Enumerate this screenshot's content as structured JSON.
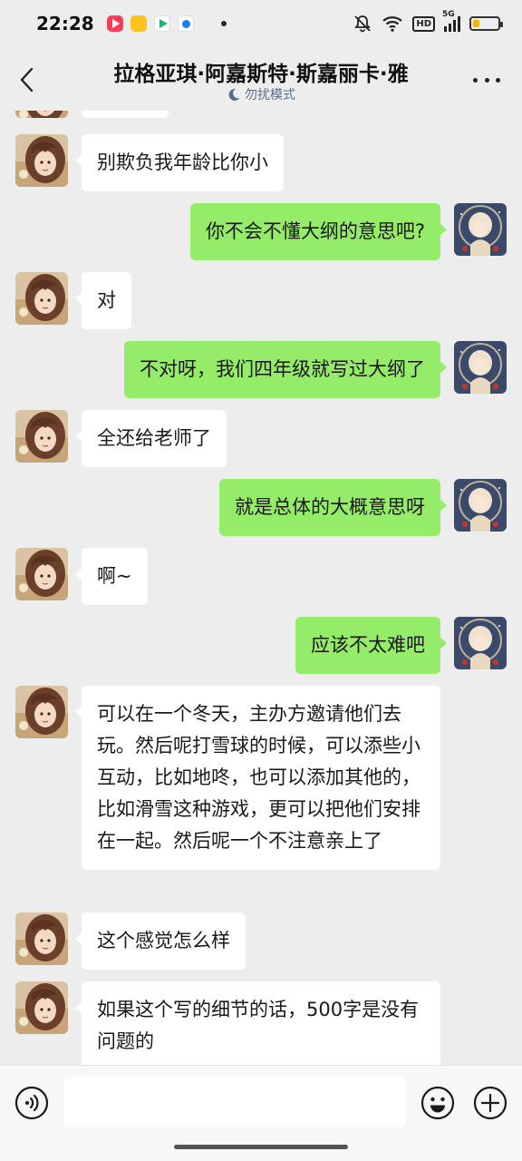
{
  "status_bar": {
    "time": "22:28",
    "network": "5G",
    "hd_label": "HD",
    "battery_level": 0.25,
    "icons": [
      "video-app-icon",
      "yellow-app-icon",
      "play-store-icon",
      "browser-app-icon",
      "wifi-icon",
      "mute-bell-icon",
      "signal-icon",
      "battery-icon"
    ]
  },
  "nav": {
    "title": "拉格亚琪·阿嘉斯特·斯嘉丽卡·雅",
    "subtitle": "勿扰模式",
    "icons": [
      "back-icon",
      "moon-icon",
      "more-icon"
    ]
  },
  "messages": [
    {
      "side": "left",
      "text": "别欺负我年龄比你小"
    },
    {
      "side": "right",
      "text": "你不会不懂大纲的意思吧?"
    },
    {
      "side": "left",
      "text": "对"
    },
    {
      "side": "right",
      "text": "不对呀，我们四年级就写过大纲了"
    },
    {
      "side": "left",
      "text": "全还给老师了"
    },
    {
      "side": "right",
      "text": "就是总体的大概意思呀"
    },
    {
      "side": "left",
      "text": "啊~"
    },
    {
      "side": "right",
      "text": "应该不太难吧"
    },
    {
      "side": "left",
      "text": "可以在一个冬天，主办方邀请他们去玩。然后呢打雪球的时候，可以添些小互动，比如地咚，也可以添加其他的，比如滑雪这种游戏，更可以把他们安排在一起。然后呢一个不注意亲上了"
    },
    {
      "side": "left",
      "text": "这个感觉怎么样"
    },
    {
      "side": "left",
      "text": "如果这个写的细节的话，500字是没有问题的"
    }
  ],
  "input_bar": {
    "text_value": "",
    "icons": [
      "voice-icon",
      "emoji-icon",
      "plus-icon"
    ]
  },
  "colors": {
    "background": "#ededed",
    "bubble_self": "#95ec69",
    "bubble_other": "#ffffff",
    "subtitle": "#5a6e8c"
  }
}
